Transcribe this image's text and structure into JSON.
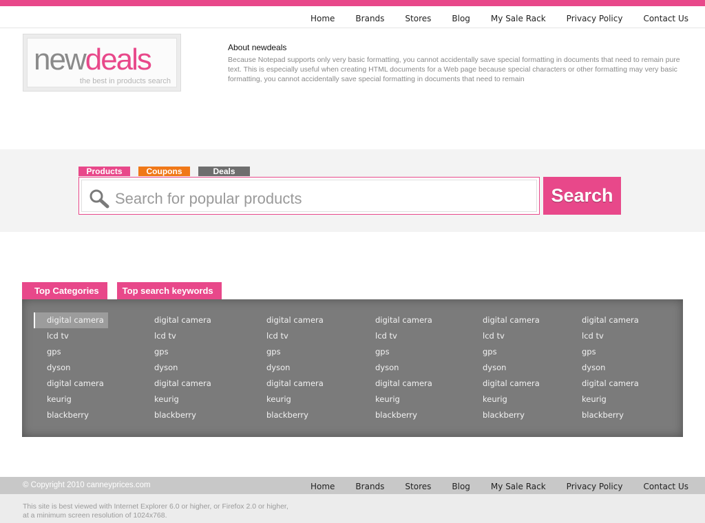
{
  "nav": {
    "items": [
      "Home",
      "Brands",
      "Stores",
      "Blog",
      "My Sale Rack",
      "Privacy Policy",
      "Contact Us"
    ]
  },
  "logo": {
    "word_part1": "new",
    "word_part2": "deals",
    "tagline": "the best in products search"
  },
  "about": {
    "title": "About newdeals",
    "body": "Because Notepad supports only very basic formatting, you cannot accidentally save special formatting in documents that need to remain pure text. This is especially useful when creating HTML documents for a Web page because special characters or other formatting may very basic formatting, you cannot accidentally save special formatting in documents that need to remain"
  },
  "search": {
    "tabs": [
      "Products",
      "Coupons",
      "Deals"
    ],
    "placeholder": "Search for popular products",
    "button_label": "Search"
  },
  "categories": {
    "tabs": [
      "Top Categories",
      "Top search keywords"
    ],
    "columns": [
      [
        "digital camera",
        "lcd tv",
        "gps",
        "dyson",
        "digital camera",
        "keurig",
        "blackberry"
      ],
      [
        "digital camera",
        "lcd tv",
        "gps",
        "dyson",
        "digital camera",
        "keurig",
        "blackberry"
      ],
      [
        "digital camera",
        "lcd tv",
        "gps",
        "dyson",
        "digital camera",
        "keurig",
        "blackberry"
      ],
      [
        "digital camera",
        "lcd tv",
        "gps",
        "dyson",
        "digital camera",
        "keurig",
        "blackberry"
      ],
      [
        "digital camera",
        "lcd tv",
        "gps",
        "dyson",
        "digital camera",
        "keurig",
        "blackberry"
      ],
      [
        "digital camera",
        "lcd tv",
        "gps",
        "dyson",
        "digital camera",
        "keurig",
        "blackberry"
      ]
    ]
  },
  "footer": {
    "copyright": "© Copyright 2010 canneyprices.com",
    "nav": [
      "Home",
      "Brands",
      "Stores",
      "Blog",
      "My Sale Rack",
      "Privacy Policy",
      "Contact Us"
    ],
    "note_line1": "This site is best viewed with Internet Explorer 6.0 or higher, or Firefox 2.0 or higher,",
    "note_line2": "at a minimum screen resolution of 1024x768."
  },
  "colors": {
    "accent": "#e8488a",
    "coupons": "#f07818",
    "deals": "#6e6e6e",
    "panel": "#7b7b7b"
  },
  "icons": {
    "search": "magnifier-icon"
  }
}
